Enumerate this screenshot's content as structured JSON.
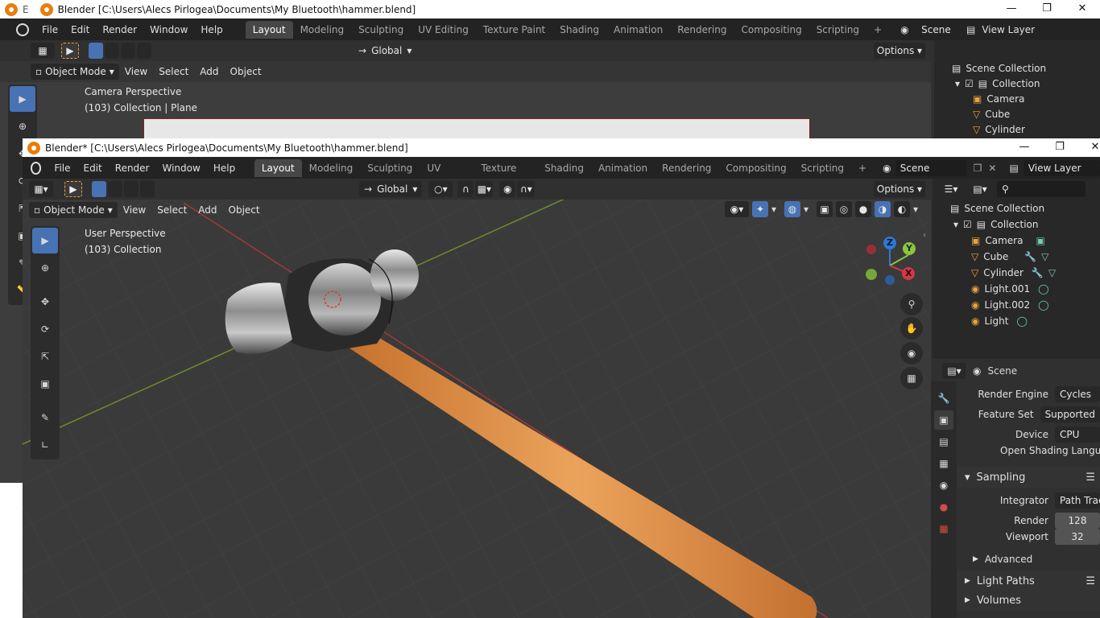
{
  "back_window": {
    "title": "Blender [C:\\Users\\Alecs Pirlogea\\Documents\\My Bluetooth\\hammer.blend]",
    "menus": [
      "File",
      "Edit",
      "Render",
      "Window",
      "Help"
    ],
    "tabs": [
      "Layout",
      "Modeling",
      "Sculpting",
      "UV Editing",
      "Texture Paint",
      "Shading",
      "Animation",
      "Rendering",
      "Compositing",
      "Scripting"
    ],
    "scene": "Scene",
    "view_layer": "View Layer",
    "transform": "Global",
    "options": "Options",
    "mode": "Object Mode",
    "view_menus": [
      "View",
      "Select",
      "Add",
      "Object"
    ],
    "overlay_title": "Camera Perspective",
    "overlay_sub": "(103) Collection | Plane",
    "outliner": {
      "root": "Scene Collection",
      "collection": "Collection",
      "items": [
        "Camera",
        "Cube",
        "Cylinder"
      ]
    },
    "edge_letter": "E"
  },
  "front_window": {
    "title": "Blender* [C:\\Users\\Alecs Pirlogea\\Documents\\My Bluetooth\\hammer.blend]",
    "menus": [
      "File",
      "Edit",
      "Render",
      "Window",
      "Help"
    ],
    "tabs": [
      "Layout",
      "Modeling",
      "Sculpting",
      "UV Editing",
      "Texture Paint",
      "Shading",
      "Animation",
      "Rendering",
      "Compositing",
      "Scripting"
    ],
    "scene": "Scene",
    "view_layer": "View Layer",
    "transform": "Global",
    "options": "Options",
    "mode": "Object Mode",
    "view_menus": [
      "View",
      "Select",
      "Add",
      "Object"
    ],
    "overlay_title": "User Perspective",
    "overlay_sub": "(103) Collection",
    "outliner": {
      "root": "Scene Collection",
      "collection": "Collection",
      "items": [
        "Camera",
        "Cube",
        "Cylinder",
        "Light.001",
        "Light.002",
        "Light"
      ]
    },
    "properties": {
      "context": "Scene",
      "render_engine_label": "Render Engine",
      "render_engine": "Cycles",
      "feature_set_label": "Feature Set",
      "feature_set": "Supported",
      "device_label": "Device",
      "device": "CPU",
      "osl_label": "Open Shading Language",
      "sampling": "Sampling",
      "integrator_label": "Integrator",
      "integrator": "Path Tracing",
      "render_label": "Render",
      "render_samples": "128",
      "viewport_label": "Viewport",
      "viewport_samples": "32",
      "advanced": "Advanced",
      "light_paths": "Light Paths",
      "volumes": "Volumes"
    },
    "gizmo": {
      "z": "Z",
      "y": "Y",
      "x": "X"
    }
  },
  "colors": {
    "accent": "#4772b3",
    "handle": "#d98a3a",
    "x_axis": "#d3374a",
    "y_axis": "#8bc53f",
    "z_axis": "#2e78d2"
  }
}
